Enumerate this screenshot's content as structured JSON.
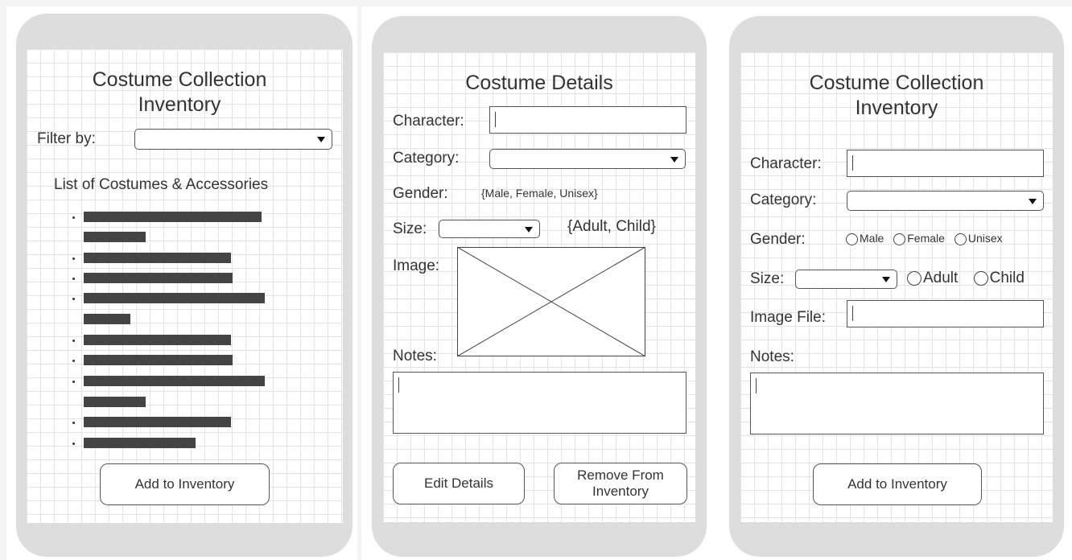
{
  "screens": {
    "list": {
      "title": "Costume Collection Inventory",
      "filter_label": "Filter by:",
      "filter_value": "",
      "list_heading": "List of Costumes & Accessories",
      "items_count": 9,
      "add_button": "Add to Inventory"
    },
    "details": {
      "title": "Costume Details",
      "character_label": "Character:",
      "category_label": "Category:",
      "gender_label": "Gender:",
      "gender_options_text": "{Male, Female, Unisex}",
      "size_label": "Size:",
      "size_options_text": "{Adult, Child}",
      "image_label": "Image:",
      "notes_label": "Notes:",
      "edit_button": "Edit Details",
      "remove_button": "Remove From Inventory"
    },
    "add": {
      "title": "Costume Collection Inventory",
      "character_label": "Character:",
      "category_label": "Category:",
      "gender_label": "Gender:",
      "gender_options": [
        "Male",
        "Female",
        "Unisex"
      ],
      "size_label": "Size:",
      "size_options": [
        "Adult",
        "Child"
      ],
      "image_file_label": "Image File:",
      "notes_label": "Notes:",
      "add_button": "Add to Inventory"
    }
  },
  "colors": {
    "phone_frame": "#dddddd",
    "grid_line": "#e4e4e4",
    "list_bar": "#444444"
  }
}
